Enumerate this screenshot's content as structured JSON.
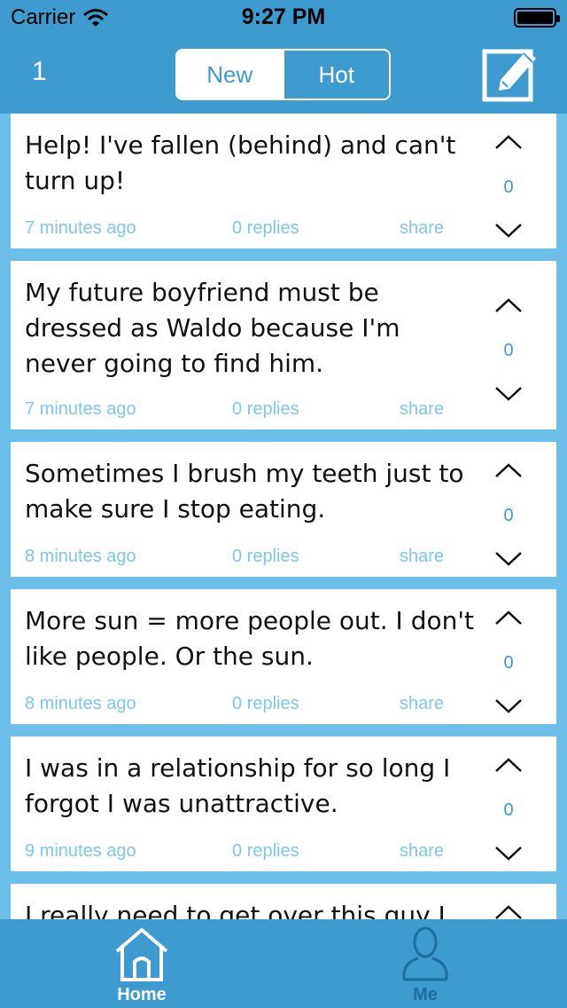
{
  "status_bar": {
    "carrier": "Carrier",
    "time": "9:27 PM"
  },
  "header": {
    "count": "1",
    "tabs": [
      {
        "label": "New",
        "selected": true
      },
      {
        "label": "Hot",
        "selected": false
      }
    ],
    "compose_icon": "compose-icon"
  },
  "posts": [
    {
      "text": "Help! I've fallen (behind) and can't turn up!",
      "time": "7 minutes ago",
      "replies": "0 replies",
      "share": "share",
      "votes": "0"
    },
    {
      "text": "My future boyfriend must be dressed as Waldo because I'm never going to find him.",
      "time": "7 minutes ago",
      "replies": "0 replies",
      "share": "share",
      "votes": "0"
    },
    {
      "text": "Sometimes I brush my teeth just to make sure I stop eating.",
      "time": "8 minutes ago",
      "replies": "0 replies",
      "share": "share",
      "votes": "0"
    },
    {
      "text": "More sun = more people out. I don't like people. Or the sun.",
      "time": "8 minutes ago",
      "replies": "0 replies",
      "share": "share",
      "votes": "0"
    },
    {
      "text": "I was in a relationship for so long I forgot I was unattractive.",
      "time": "9 minutes ago",
      "replies": "0 replies",
      "share": "share",
      "votes": "0"
    },
    {
      "text": "I really need to get over this guy I",
      "time": "",
      "replies": "",
      "share": "",
      "votes": ""
    }
  ],
  "tab_bar": {
    "items": [
      {
        "label": "Home",
        "icon": "home-icon",
        "active": true
      },
      {
        "label": "Me",
        "icon": "person-icon",
        "active": false
      }
    ]
  },
  "colors": {
    "primary": "#3d9bd0",
    "background": "#6bbfe8",
    "meta_text": "#7fc6ea"
  }
}
